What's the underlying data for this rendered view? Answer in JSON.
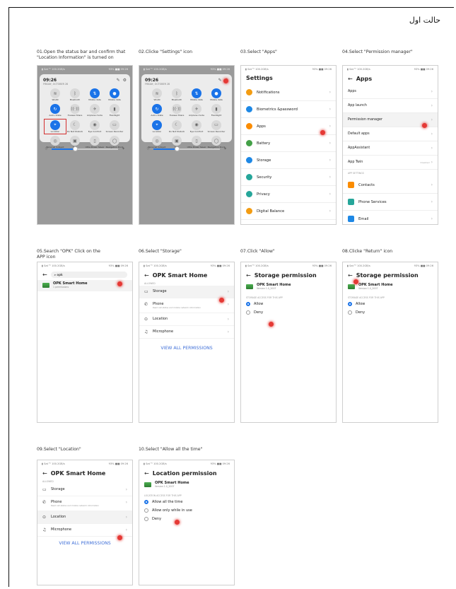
{
  "doc": {
    "title": "حالت اول"
  },
  "colors": {
    "accent": "#1a73e8",
    "marker": "#e53935",
    "frame": "#111111"
  },
  "steps": [
    {
      "caption": "01.Open the status bar and confirm that \"Location Information\" is turned on"
    },
    {
      "caption": "02.Clicke  \"Settings\" icon"
    },
    {
      "caption": "03.Select  \"Apps\""
    },
    {
      "caption": "04.Select  \"Permission manager\""
    },
    {
      "caption": "05.Search  \"OPK\" Click on the APP icon"
    },
    {
      "caption": "06.Select  \"Storage\""
    },
    {
      "caption": "07.Click  \"Allow\""
    },
    {
      "caption": "08.Clicke  \"Return\"  icon"
    },
    {
      "caption": "09.Select  \"Location\""
    },
    {
      "caption": "10.Select  \"Allow all the time\""
    }
  ],
  "status": {
    "left": "▮ Sat  ᵀᵃ  100.2GB/s",
    "right": "93% ■■ 09:26"
  },
  "quick_panel": {
    "time": "09:26",
    "date": "FRIDAY, OCTOBER 28",
    "icons": [
      "edit-icon",
      "settings-icon"
    ],
    "tiles": [
      {
        "label": "WLAN",
        "on": false,
        "icon": "wifi-icon",
        "glyph": "≋"
      },
      {
        "label": "Bluetooth",
        "on": false,
        "icon": "bluetooth-icon",
        "glyph": "ᛒ"
      },
      {
        "label": "Mobile data",
        "on": true,
        "icon": "mobile-data-icon",
        "glyph": "⇅"
      },
      {
        "label": "Mobile data",
        "on": true,
        "icon": "bell-icon",
        "glyph": "●"
      },
      {
        "label": "Auto-rotate",
        "on": true,
        "icon": "rotate-icon",
        "glyph": "↻"
      },
      {
        "label": "Huawei Share",
        "on": false,
        "icon": "share-icon",
        "glyph": "((·))"
      },
      {
        "label": "Airplane mode",
        "on": false,
        "icon": "airplane-icon",
        "glyph": "✈"
      },
      {
        "label": "Flashlight",
        "on": false,
        "icon": "flashlight-icon",
        "glyph": "▮"
      },
      {
        "label": "Location",
        "on": true,
        "icon": "location-icon",
        "glyph": "⌖"
      },
      {
        "label": "Do Not Disturb",
        "on": false,
        "icon": "moon-icon",
        "glyph": "☾"
      },
      {
        "label": "Eye Comfort",
        "on": false,
        "icon": "eye-icon",
        "glyph": "◉"
      },
      {
        "label": "Screen Recorder",
        "on": false,
        "icon": "recorder-icon",
        "glyph": "▭"
      },
      {
        "label": "Personal hotspot",
        "on": false,
        "icon": "hotspot-icon",
        "glyph": "◎"
      },
      {
        "label": "NFC",
        "on": false,
        "icon": "nfc-icon",
        "glyph": "▣"
      },
      {
        "label": "Ultra Power Saver",
        "on": false,
        "icon": "power-saver-icon",
        "glyph": "▯"
      },
      {
        "label": "Navigation Dock",
        "on": false,
        "icon": "dock-icon",
        "glyph": "◯"
      }
    ],
    "brightness": 0.35
  },
  "settings": {
    "title": "Settings",
    "items": [
      {
        "label": "Notifications",
        "color": "#f39c12"
      },
      {
        "label": "Biometrics &password",
        "color": "#1e88e5"
      },
      {
        "label": "Apps",
        "color": "#fb8c00"
      },
      {
        "label": "Battery",
        "color": "#43a047"
      },
      {
        "label": "Storage",
        "color": "#1e88e5"
      },
      {
        "label": "Security",
        "color": "#26a69a"
      },
      {
        "label": "Privacy",
        "color": "#26a69a"
      },
      {
        "label": "Digital Balance",
        "color": "#f39c12"
      }
    ]
  },
  "apps": {
    "title": "Apps",
    "items": [
      "Apps",
      "App launch",
      "Permission manager",
      "Default apps",
      "AppAssistant",
      "App Twin"
    ],
    "app_twin_value": "Disabled",
    "section": "APP SETTINGS",
    "sub_items": [
      {
        "label": "Contacts",
        "color": "#fb8c00"
      },
      {
        "label": "Phone Services",
        "color": "#26a69a"
      },
      {
        "label": "Email",
        "color": "#1e88e5"
      }
    ]
  },
  "search": {
    "query": "opk"
  },
  "app": {
    "name": "OPK Smart Home",
    "sub": "1 permissions",
    "version": "Version 1.0_2007"
  },
  "permissions": {
    "title": "OPK Smart Home",
    "section": "ALLOWED",
    "items": [
      {
        "label": "Storage",
        "icon": "folder-icon",
        "glyph": "▭"
      },
      {
        "label": "Phone",
        "icon": "phone-icon",
        "glyph": "✆",
        "sub": "Read call status and mobile network information"
      },
      {
        "label": "Location",
        "icon": "location-icon",
        "glyph": "⊙"
      },
      {
        "label": "Microphone",
        "icon": "microphone-icon",
        "glyph": "♫"
      }
    ],
    "view_all": "VIEW ALL PERMISSIONS"
  },
  "storage_perm": {
    "title": "Storage permission",
    "section": "STORAGE ACCESS FOR THIS APP",
    "options": [
      "Allow",
      "Deny"
    ]
  },
  "location_perm": {
    "title": "Location permission",
    "section": "LOCATION ACCESS FOR THIS APP",
    "options": [
      "Allow all the time",
      "Allow only while in use",
      "Deny"
    ]
  }
}
